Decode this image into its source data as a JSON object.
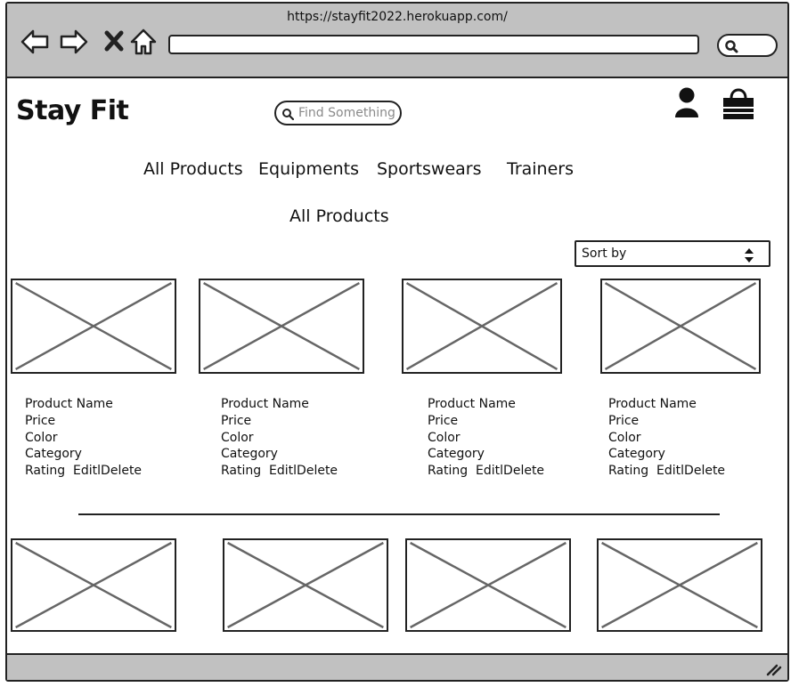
{
  "browser": {
    "url": "https://stayfit2022.herokuapp.com/",
    "icons": [
      "back-arrow-icon",
      "forward-arrow-icon",
      "close-icon",
      "home-icon",
      "search-icon"
    ]
  },
  "header": {
    "logo": "Stay Fit",
    "search_placeholder": "Find Something",
    "icons": [
      "user-icon",
      "shopping-bag-icon"
    ]
  },
  "nav": {
    "items": [
      "All Products",
      "Equipments",
      "Sportswears",
      "Trainers"
    ]
  },
  "main": {
    "heading": "All Products",
    "sort_label": "Sort by",
    "products": [
      {
        "name": "Product Name",
        "price": "Price",
        "color": "Color",
        "category": "Category",
        "rating": "Rating",
        "actions": "EditlDelete"
      },
      {
        "name": "Product Name",
        "price": "Price",
        "color": "Color",
        "category": "Category",
        "rating": "Rating",
        "actions": "EditlDelete"
      },
      {
        "name": "Product Name",
        "price": "Price",
        "color": "Color",
        "category": "Category",
        "rating": "Rating",
        "actions": "EditlDelete"
      },
      {
        "name": "Product Name",
        "price": "Price",
        "color": "Color",
        "category": "Category",
        "rating": "Rating",
        "actions": "EditlDelete"
      }
    ]
  },
  "colors": {
    "chrome": "#c1c1c1",
    "placeholder_cross": "#666666",
    "search_placeholder_text": "#8a8a8a"
  }
}
